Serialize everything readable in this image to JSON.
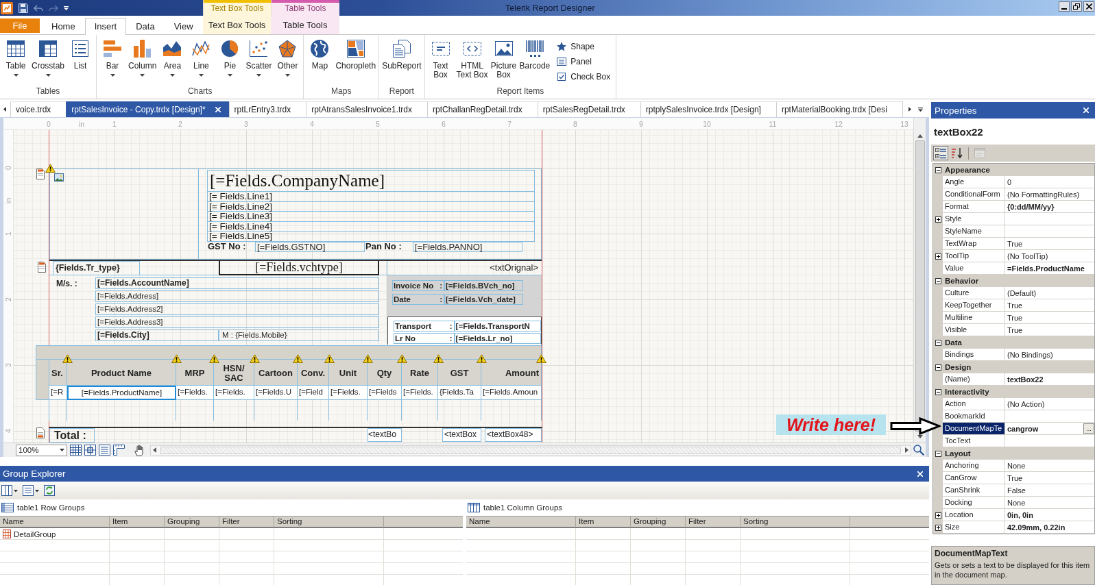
{
  "window": {
    "title": "Telerik Report Designer"
  },
  "ribbon": {
    "file_tab": "File",
    "tabs": [
      {
        "label": "Home",
        "selected": false
      },
      {
        "label": "Insert",
        "selected": true
      },
      {
        "label": "Data",
        "selected": false
      },
      {
        "label": "View",
        "selected": false
      }
    ],
    "context_tabs": [
      {
        "header": "Text Box Tools",
        "label": "Text Box Tools",
        "color": "#f0c000"
      },
      {
        "header": "Table Tools",
        "label": "Table Tools",
        "color": "#d45aae"
      }
    ],
    "groups": [
      {
        "label": "Tables",
        "items": [
          {
            "kind": "table",
            "label": "Table",
            "dropdown": true
          },
          {
            "kind": "crosstab",
            "label": "Crosstab",
            "dropdown": true
          },
          {
            "kind": "list",
            "label": "List",
            "dropdown": false
          }
        ]
      },
      {
        "label": "Charts",
        "items": [
          {
            "kind": "bar",
            "label": "Bar",
            "dropdown": true
          },
          {
            "kind": "column",
            "label": "Column",
            "dropdown": true
          },
          {
            "kind": "area",
            "label": "Area",
            "dropdown": true
          },
          {
            "kind": "line",
            "label": "Line",
            "dropdown": true
          },
          {
            "kind": "pie",
            "label": "Pie",
            "dropdown": true
          },
          {
            "kind": "scatter",
            "label": "Scatter",
            "dropdown": true
          },
          {
            "kind": "radar",
            "label": "Other",
            "dropdown": true
          }
        ]
      },
      {
        "label": "Maps",
        "items": [
          {
            "kind": "map",
            "label": "Map",
            "dropdown": false
          },
          {
            "kind": "choropleth",
            "label": "Choropleth",
            "dropdown": false
          }
        ]
      },
      {
        "label": "Report",
        "items": [
          {
            "kind": "subreport",
            "label": "SubReport",
            "dropdown": false
          }
        ]
      },
      {
        "label": "Report Items",
        "items": [
          {
            "kind": "textbox",
            "label": "Text\nBox",
            "dropdown": false
          },
          {
            "kind": "htmltextbox",
            "label": "HTML\nText Box",
            "dropdown": false
          },
          {
            "kind": "picturebox",
            "label": "Picture\nBox",
            "dropdown": false
          },
          {
            "kind": "barcode",
            "label": "Barcode",
            "dropdown": false
          }
        ],
        "small_items": [
          {
            "kind": "shape",
            "label": "Shape"
          },
          {
            "kind": "panel",
            "label": "Panel"
          },
          {
            "kind": "checkbox",
            "label": "Check Box"
          }
        ]
      }
    ]
  },
  "document_tabs": [
    {
      "label": "voice.trdx",
      "selected": false
    },
    {
      "label": "rptSalesInvoice - Copy.trdx [Design]*",
      "selected": true
    },
    {
      "label": "rptLrEntry3.trdx",
      "selected": false
    },
    {
      "label": "rptAtransSalesInvoice1.trdx",
      "selected": false
    },
    {
      "label": "rptChallanRegDetail.trdx",
      "selected": false
    },
    {
      "label": "rptSalesRegDetail.trdx",
      "selected": false
    },
    {
      "label": "rptplySalesInvoice.trdx [Design]",
      "selected": false
    },
    {
      "label": "rptMaterialBooking.trdx [Desi",
      "selected": false
    }
  ],
  "designer": {
    "ruler": {
      "top_unit": "in",
      "top_labels": [
        "0",
        "1",
        "2",
        "3",
        "4",
        "5",
        "6",
        "7",
        "8",
        "9",
        "10",
        "11",
        "12",
        "13"
      ],
      "side_unit": "in",
      "side_labels": [
        "0",
        "1",
        "2",
        "3",
        "4"
      ]
    },
    "report": {
      "page_header": {
        "warning": true,
        "company": "[=Fields.CompanyName]",
        "lines": [
          "[= Fields.Line1]",
          "[= Fields.Line2]",
          "[= Fields.Line3]",
          "[= Fields.Line4]",
          "[= Fields.Line5]"
        ],
        "tax_ids": [
          {
            "label": "GST No :",
            "value": "[=Fields.GSTNO]"
          },
          {
            "label": "Pan No :",
            "value": "[=Fields.PANNO]"
          }
        ]
      },
      "title_row": {
        "type": "{Fields.Tr_type}",
        "voucher_type": "[=Fields.vchtype]",
        "copy_label": "<txtOrignal>"
      },
      "party": {
        "label": "M/s. :",
        "lines": [
          {
            "text": "[=Fields.AccountName]",
            "bold": true
          },
          {
            "text": "[=Fields.Address]",
            "bold": false
          },
          {
            "text": "[=Fields.Address2]",
            "bold": false
          },
          {
            "text": "[=Fields.Address3]",
            "bold": false
          },
          {
            "text": "[=Fields.City]",
            "bold": true
          }
        ],
        "mobile": "M : {Fields.Mobile}"
      },
      "invoice_box": [
        {
          "label": "Invoice No",
          "separator": ":",
          "value": "[=Fields.BVch_no]"
        },
        {
          "label": "Date",
          "separator": ":",
          "value": "[=Fields.Vch_date]"
        }
      ],
      "transport_box": [
        {
          "label": "Transport",
          "separator": ":",
          "value": "[=Fields.TransportN"
        },
        {
          "label": "Lr No",
          "separator": ":",
          "value": "[=Fields.Lr_no]"
        }
      ],
      "table": {
        "columns": [
          {
            "header": "Sr.",
            "cell": "[=R",
            "selected": false,
            "warning": false
          },
          {
            "header": "Product Name",
            "cell": "[=Fields.ProductName]",
            "selected": true,
            "warning": true
          },
          {
            "header": "MRP",
            "cell": "[=Fields.",
            "selected": false,
            "warning": true
          },
          {
            "header": "HSN/\nSAC",
            "cell": "[=Fields.",
            "selected": false,
            "warning": true
          },
          {
            "header": "Cartoon",
            "cell": "[=Fields.U",
            "selected": false,
            "warning": true
          },
          {
            "header": "Conv.",
            "cell": "[=Field",
            "selected": false,
            "warning": true
          },
          {
            "header": "Unit",
            "cell": "[=Fields.",
            "selected": false,
            "warning": true
          },
          {
            "header": "Qty",
            "cell": "[=Fields",
            "selected": false,
            "warning": true
          },
          {
            "header": "Rate",
            "cell": "[=Fields.",
            "selected": false,
            "warning": true
          },
          {
            "header": "GST",
            "cell": "{Fields.Ta",
            "selected": false,
            "warning": true
          },
          {
            "header": "Amount",
            "cell": "[=Fields.Amoun",
            "selected": false,
            "warning": true
          }
        ],
        "end_warning": true
      },
      "footer": {
        "label": "Total :",
        "cells": [
          "<textBo",
          "<textBox",
          "<textBox48>"
        ]
      }
    },
    "zoom": "100%"
  },
  "annotation": {
    "text": "Write here!"
  },
  "properties": {
    "title": "Properties",
    "object_name": "textBox22",
    "toolbar": [
      {
        "kind": "categorized",
        "selected": true,
        "disabled": false
      },
      {
        "kind": "alphabetical",
        "selected": false,
        "disabled": false
      },
      {
        "kind": "property_pages",
        "selected": false,
        "disabled": true
      }
    ],
    "categories": [
      {
        "name": "Appearance",
        "expanded": true,
        "rows": [
          {
            "name": "Angle",
            "value": "0",
            "modified": false,
            "expandable": false,
            "selected": false
          },
          {
            "name": "ConditionalForm",
            "value": "(No FormattingRules)",
            "modified": false,
            "expandable": false,
            "selected": false
          },
          {
            "name": "Format",
            "value": "{0:dd/MM/yy}",
            "modified": true,
            "expandable": false,
            "selected": false
          },
          {
            "name": "Style",
            "expandable": true,
            "selected": false
          },
          {
            "name": "StyleName",
            "expandable": false,
            "selected": false
          },
          {
            "name": "TextWrap",
            "value": "True",
            "modified": false,
            "expandable": false,
            "selected": false
          },
          {
            "name": "ToolTip",
            "value": "(No ToolTip)",
            "modified": false,
            "expandable": true,
            "selected": false
          },
          {
            "name": "Value",
            "value": "=Fields.ProductName",
            "modified": true,
            "expandable": false,
            "selected": false
          }
        ]
      },
      {
        "name": "Behavior",
        "expanded": true,
        "rows": [
          {
            "name": "Culture",
            "value": "(Default)",
            "modified": false,
            "expandable": false,
            "selected": false
          },
          {
            "name": "KeepTogether",
            "value": "True",
            "modified": false,
            "expandable": false,
            "selected": false
          },
          {
            "name": "Multiline",
            "value": "True",
            "modified": false,
            "expandable": false,
            "selected": false
          },
          {
            "name": "Visible",
            "value": "True",
            "modified": false,
            "expandable": false,
            "selected": false
          }
        ]
      },
      {
        "name": "Data",
        "expanded": true,
        "rows": [
          {
            "name": "Bindings",
            "value": "(No Bindings)",
            "modified": false,
            "expandable": false,
            "selected": false
          }
        ]
      },
      {
        "name": "Design",
        "expanded": true,
        "rows": [
          {
            "name": "(Name)",
            "value": "textBox22",
            "modified": true,
            "expandable": false,
            "selected": false
          }
        ]
      },
      {
        "name": "Interactivity",
        "expanded": true,
        "rows": [
          {
            "name": "Action",
            "value": "(No Action)",
            "modified": false,
            "expandable": false,
            "selected": false
          },
          {
            "name": "BookmarkId",
            "expandable": false,
            "selected": false
          },
          {
            "name": "DocumentMapTe",
            "value": "cangrow",
            "modified": true,
            "expandable": false,
            "selected": true,
            "editor_button": "..."
          },
          {
            "name": "TocText",
            "expandable": false,
            "selected": false
          }
        ]
      },
      {
        "name": "Layout",
        "expanded": true,
        "rows": [
          {
            "name": "Anchoring",
            "value": "None",
            "modified": false,
            "expandable": false,
            "selected": false
          },
          {
            "name": "CanGrow",
            "value": "True",
            "modified": false,
            "expandable": false,
            "selected": false
          },
          {
            "name": "CanShrink",
            "value": "False",
            "modified": false,
            "expandable": false,
            "selected": false
          },
          {
            "name": "Docking",
            "value": "None",
            "modified": false,
            "expandable": false,
            "selected": false
          },
          {
            "name": "Location",
            "value": "0in, 0in",
            "modified": true,
            "expandable": true,
            "selected": false
          },
          {
            "name": "Size",
            "value": "42.09mm, 0.22in",
            "modified": true,
            "expandable": true,
            "selected": false
          }
        ]
      }
    ],
    "description": {
      "title": "DocumentMapText",
      "text": "Gets or sets a text to be displayed for this item in the document map."
    }
  },
  "group_explorer": {
    "title": "Group Explorer",
    "panes": [
      {
        "kind": "rows",
        "title": "table1 Row Groups",
        "columns": [
          "Name",
          "Item",
          "Grouping",
          "Filter",
          "Sorting"
        ],
        "rows": [
          "DetailGroup"
        ]
      },
      {
        "kind": "columns",
        "title": "table1 Column Groups",
        "columns": [
          "Name",
          "Item",
          "Grouping",
          "Filter",
          "Sorting"
        ]
      }
    ]
  }
}
